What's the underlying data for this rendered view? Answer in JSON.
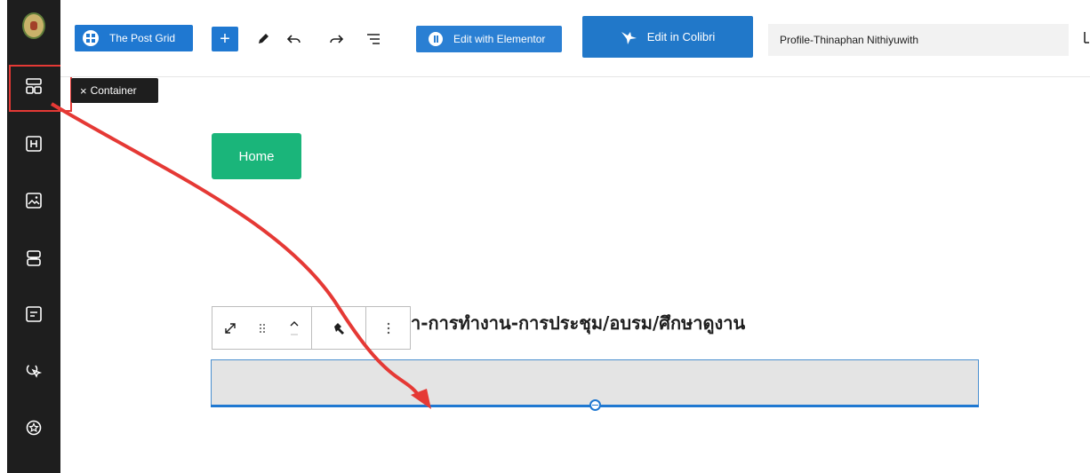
{
  "toolbar": {
    "post_grid_label": "The Post Grid",
    "add_symbol": "+",
    "edit_elementor_label": "Edit with Elementor",
    "edit_colibri_label": "Edit in Colibri",
    "document_title": "Profile-Thinaphan Nithiyuwith"
  },
  "tooltip": {
    "close_symbol": "×",
    "label": "Container"
  },
  "canvas": {
    "home_button_label": "Home",
    "heading_text": "า-การทำงาน-การประชุม/อบรม/ศึกษาดูงาน"
  },
  "sidebar": {
    "items": [
      {
        "name": "container-block-icon"
      },
      {
        "name": "heading-block-icon"
      },
      {
        "name": "image-block-icon"
      },
      {
        "name": "rows-block-icon"
      },
      {
        "name": "form-block-icon"
      },
      {
        "name": "click-icon"
      },
      {
        "name": "star-badge-icon"
      }
    ]
  },
  "colors": {
    "sidebar_bg": "#1e1e1e",
    "accent_blue": "#1f78d1",
    "home_green": "#1ab57a",
    "annotation_red": "#e53935"
  }
}
